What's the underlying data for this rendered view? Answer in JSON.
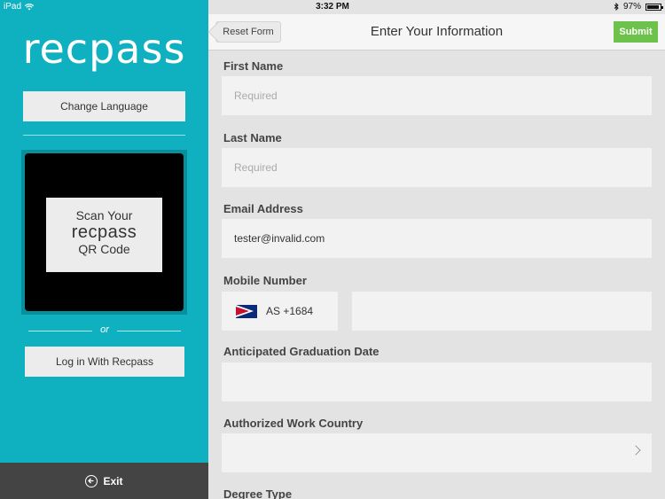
{
  "status_bar": {
    "device": "iPad",
    "time": "3:32 PM",
    "battery": "97%"
  },
  "left": {
    "logo": "recpass",
    "change_language": "Change Language",
    "qr_card": {
      "line1": "Scan Your",
      "line2": "recpass",
      "line3": "QR Code"
    },
    "or": "or",
    "login_button": "Log in With Recpass",
    "exit": "Exit"
  },
  "nav": {
    "reset": "Reset Form",
    "title": "Enter Your Information",
    "submit": "Submit"
  },
  "form": {
    "first_name": {
      "label": "First Name",
      "placeholder": "Required"
    },
    "last_name": {
      "label": "Last Name",
      "placeholder": "Required"
    },
    "email": {
      "label": "Email Address",
      "value": "tester@invalid.com"
    },
    "mobile": {
      "label": "Mobile Number",
      "country_code": "AS +1684",
      "value": ""
    },
    "graduation": {
      "label": "Anticipated Graduation Date",
      "value": ""
    },
    "work_country": {
      "label": "Authorized Work Country",
      "value": ""
    },
    "degree": {
      "label": "Degree Type"
    }
  },
  "colors": {
    "teal": "#0fb1c1",
    "submit_green": "#6cc24a",
    "exit_bar": "#444444"
  }
}
